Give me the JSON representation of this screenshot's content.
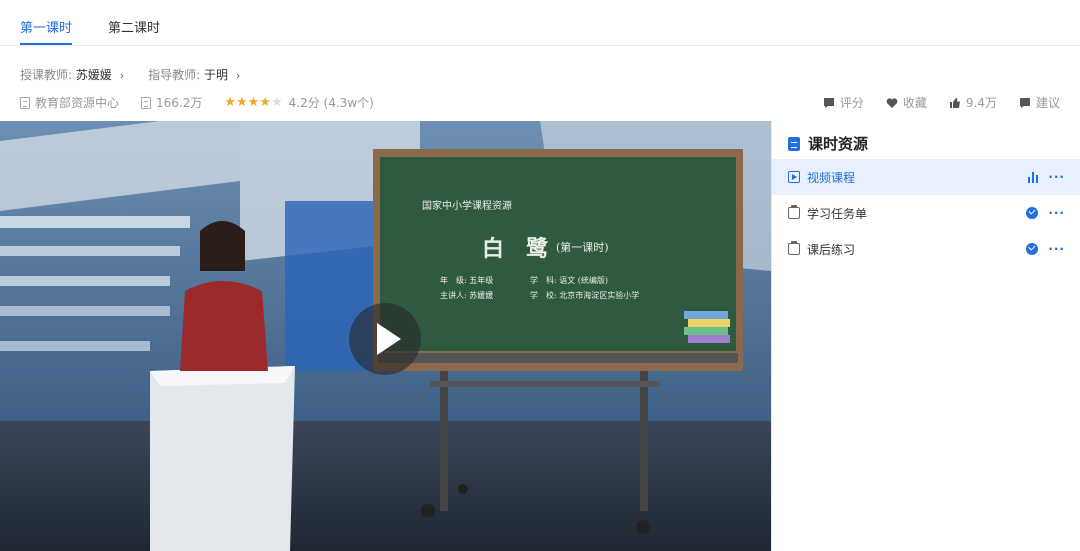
{
  "tabs": [
    {
      "label": "第一课时",
      "active": true
    },
    {
      "label": "第二课时",
      "active": false
    }
  ],
  "teachers": {
    "lecturer_label": "授课教师:",
    "lecturer_name": "苏媛媛",
    "advisor_label": "指导教师:",
    "advisor_name": "于明",
    "chevron": "›"
  },
  "meta": {
    "source": "教育部资源中心",
    "views": "166.2万",
    "stars": "★★★★",
    "half_star": "★",
    "rating": "4.2分 (4.3w个)",
    "rating_value": 4.2
  },
  "actions": {
    "rate": "评分",
    "favorite": "收藏",
    "likes": "9.4万",
    "suggest": "建议"
  },
  "video": {
    "board_header": "国家中小学课程资源",
    "board_title": "白　鹭",
    "board_subtitle": "(第一课时)",
    "board_grade": "年　级: 五年级",
    "board_subject": "学　科: 语文 (统编版)",
    "board_speaker": "主讲人: 苏媛媛",
    "board_school": "学　校: 北京市海淀区实验小学"
  },
  "sidebar": {
    "title": "课时资源",
    "items": [
      {
        "label": "视频课程",
        "active": true,
        "icon": "video-icon"
      },
      {
        "label": "学习任务单",
        "active": false,
        "icon": "clipboard-icon"
      },
      {
        "label": "课后练习",
        "active": false,
        "icon": "clipboard-icon"
      }
    ],
    "more": "···"
  },
  "colors": {
    "accent": "#1f6fe0",
    "star": "#f5a623"
  }
}
